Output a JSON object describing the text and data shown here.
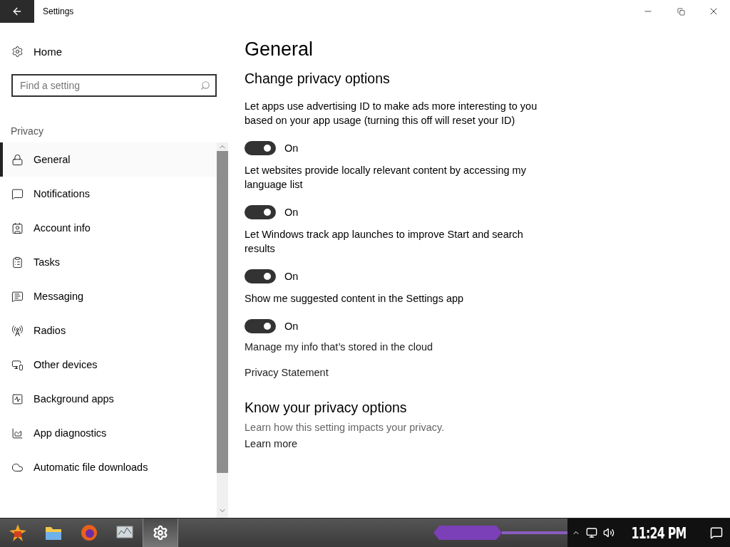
{
  "window": {
    "title": "Settings"
  },
  "sidebar": {
    "home": "Home",
    "search": {
      "placeholder": "Find a setting"
    },
    "section": "Privacy",
    "items": [
      {
        "label": "General",
        "selected": true
      },
      {
        "label": "Notifications",
        "selected": false
      },
      {
        "label": "Account info",
        "selected": false
      },
      {
        "label": "Tasks",
        "selected": false
      },
      {
        "label": "Messaging",
        "selected": false
      },
      {
        "label": "Radios",
        "selected": false
      },
      {
        "label": "Other devices",
        "selected": false
      },
      {
        "label": "Background apps",
        "selected": false
      },
      {
        "label": "App diagnostics",
        "selected": false
      },
      {
        "label": "Automatic file downloads",
        "selected": false
      }
    ]
  },
  "content": {
    "title": "General",
    "section_title": "Change privacy options",
    "options": [
      {
        "label": "Let apps use advertising ID to make ads more interesting to you based on your app usage (turning this off will reset your ID)",
        "on": true,
        "state_label": "On"
      },
      {
        "label": "Let websites provide locally relevant content by accessing my language list",
        "on": true,
        "state_label": "On"
      },
      {
        "label": "Let Windows track app launches to improve Start and search results",
        "on": true,
        "state_label": "On"
      },
      {
        "label": "Show me suggested content in the Settings app",
        "on": true,
        "state_label": "On"
      }
    ],
    "links": [
      "Manage my info that’s stored in the cloud",
      "Privacy Statement"
    ],
    "know": {
      "title": "Know your privacy options",
      "description": "Learn how this setting impacts your privacy.",
      "link": "Learn more"
    }
  },
  "taskbar": {
    "apps": [
      {
        "selected": false
      },
      {
        "selected": false
      },
      {
        "selected": false
      },
      {
        "selected": false
      },
      {
        "selected": true
      }
    ],
    "clock": "11:24 PM"
  }
}
